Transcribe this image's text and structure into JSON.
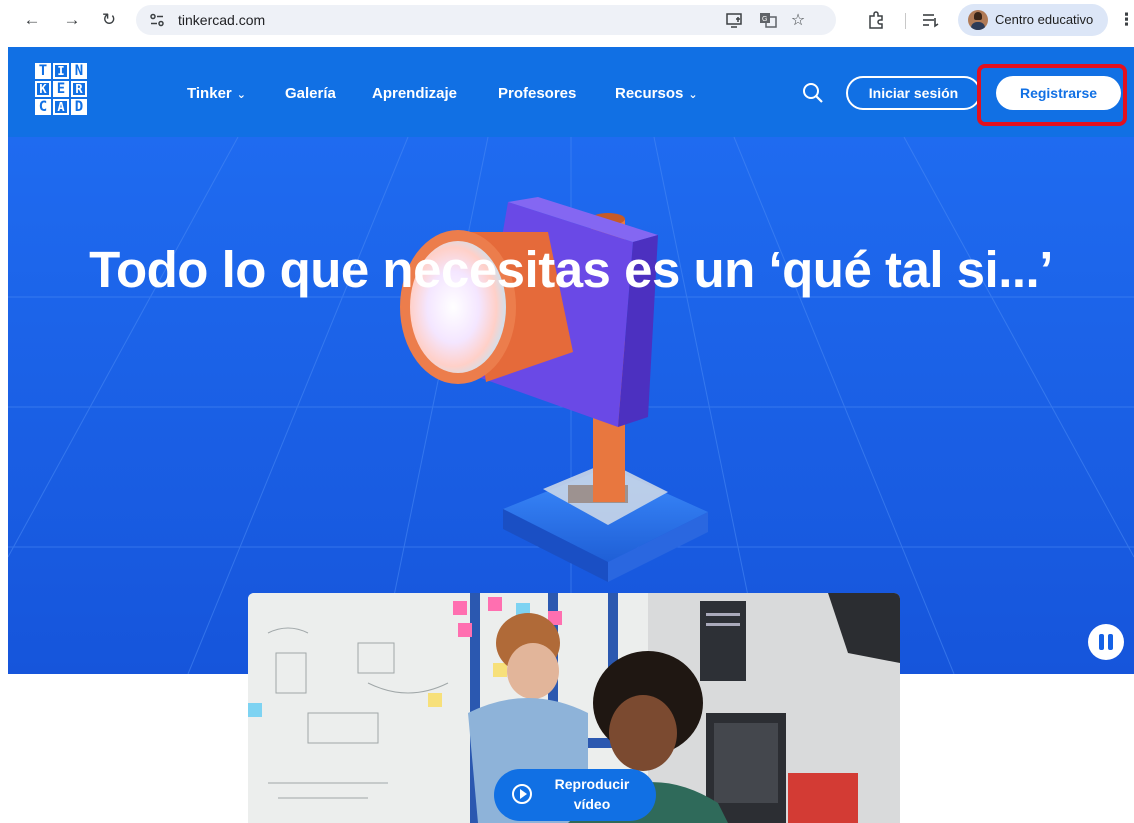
{
  "browser": {
    "url": "tinkercad.com",
    "profile_label": "Centro educativo",
    "icons": [
      "back-arrow-icon",
      "forward-arrow-icon",
      "reload-icon",
      "site-settings-icon",
      "install-app-icon",
      "translate-icon",
      "star-icon",
      "extensions-icon",
      "reading-list-icon",
      "profile-avatar-icon",
      "more-menu-icon"
    ]
  },
  "header": {
    "logo_letters": [
      "T",
      "I",
      "N",
      "K",
      "E",
      "R",
      "C",
      "A",
      "D"
    ],
    "menu": [
      {
        "label": "Tinker",
        "has_dropdown": true
      },
      {
        "label": "Galería",
        "has_dropdown": false
      },
      {
        "label": "Aprendizaje",
        "has_dropdown": false
      },
      {
        "label": "Profesores",
        "has_dropdown": false
      },
      {
        "label": "Recursos",
        "has_dropdown": true
      }
    ],
    "login_label": "Iniciar sesión",
    "register_label": "Registrarse"
  },
  "hero": {
    "title": "Todo lo que necesitas es un ‘qué tal si...’"
  },
  "video": {
    "play_label_line1": "Reproducir",
    "play_label_line2": "vídeo"
  },
  "colors": {
    "brand_blue": "#1170e4",
    "hero_blue": "#1461e6",
    "highlight_red": "#e3101e"
  }
}
